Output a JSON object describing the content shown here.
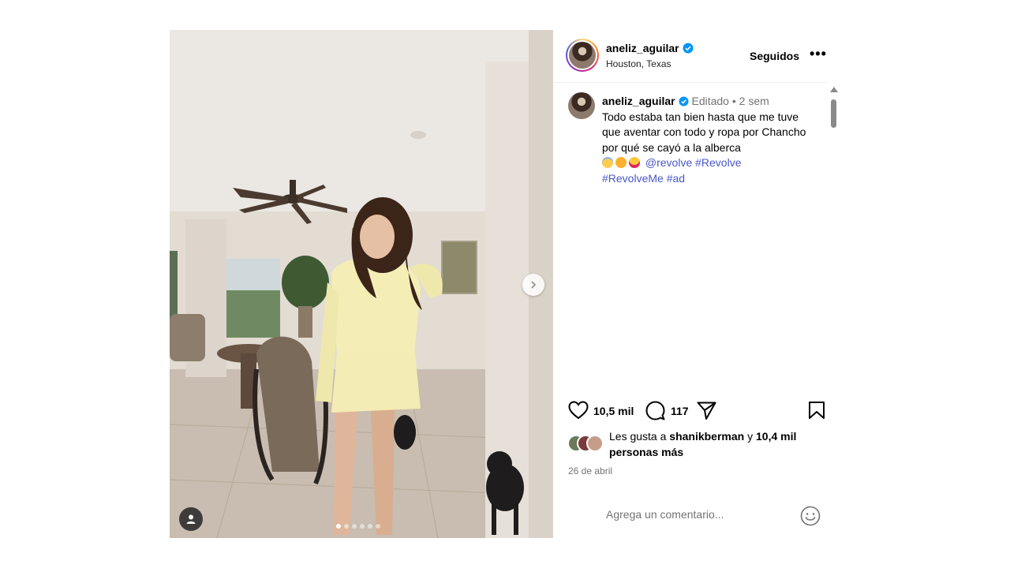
{
  "post": {
    "username": "aneliz_aguilar",
    "location": "Houston, Texas",
    "follow_status": "Seguidos",
    "more_label": "•••",
    "photo_count": 6,
    "active_photo_index": 0
  },
  "caption": {
    "username": "aneliz_aguilar",
    "edited_label": "Editado",
    "separator": "•",
    "time_ago": "2 sem",
    "text": "Todo estaba tan bien hasta que me tuve que aventar con todo y ropa por Chancho por qué se cayó a la alberca",
    "emojis": [
      "smiling-face-with-halo",
      "face-blowing-kiss",
      "smiling-face-with-heart-eyes"
    ],
    "mention": "@revolve",
    "hashtags": [
      "#Revolve",
      "#RevolveMe",
      "#ad"
    ]
  },
  "actions": {
    "likes_count": "10,5 mil",
    "comments_count": "117"
  },
  "likes": {
    "prefix": "Les gusta a",
    "liked_by": "shanikberman",
    "connector": "y",
    "others_count": "10,4 mil",
    "others_suffix": "personas más"
  },
  "date": "26 de abril",
  "comment": {
    "placeholder": "Agrega un comentario..."
  },
  "colors": {
    "link": "#4a57c9",
    "verified": "#0095f6",
    "muted": "#737373"
  }
}
